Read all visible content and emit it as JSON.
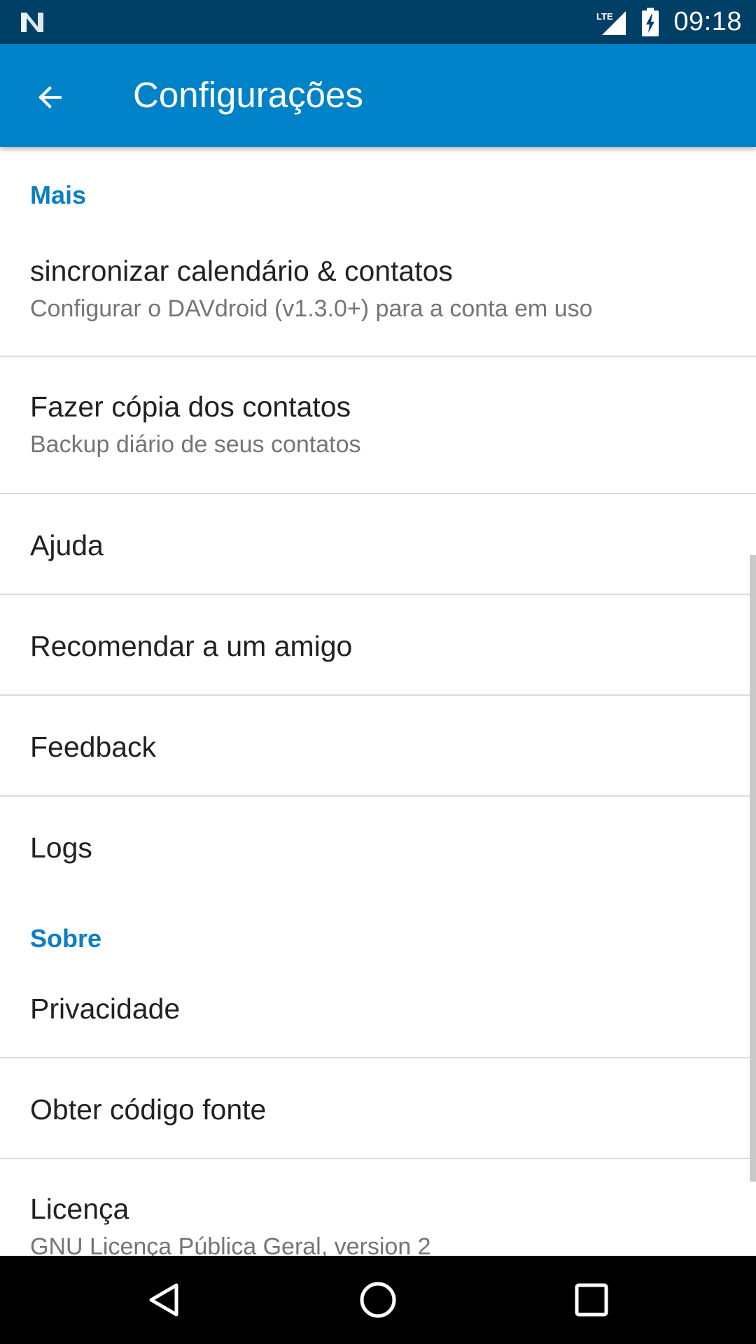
{
  "status_bar": {
    "time": "09:18",
    "network_label": "LTE",
    "icons": [
      "notification-n-icon",
      "lte-signal-icon",
      "battery-charging-icon"
    ]
  },
  "app_bar": {
    "title": "Configurações",
    "back_icon": "arrow-back-icon"
  },
  "sections": {
    "more": {
      "header": "Mais",
      "items": [
        {
          "title": "sincronizar calendário & contatos",
          "summary": "Configurar o DAVdroid (v1.3.0+) para a conta em uso"
        },
        {
          "title": "Fazer cópia dos contatos",
          "summary": "Backup diário de seus contatos"
        },
        {
          "title": "Ajuda"
        },
        {
          "title": "Recomendar a um amigo"
        },
        {
          "title": "Feedback"
        },
        {
          "title": "Logs"
        }
      ]
    },
    "about": {
      "header": "Sobre",
      "items": [
        {
          "title": "Privacidade"
        },
        {
          "title": "Obter código fonte"
        },
        {
          "title": "Licença",
          "summary": "GNU Licença Pública Geral, version 2"
        }
      ]
    }
  },
  "nav_bar": {
    "icons": [
      "nav-back-icon",
      "nav-home-icon",
      "nav-recents-icon"
    ]
  },
  "colors": {
    "status_bar": "#003f66",
    "app_bar": "#0082c8",
    "section_header": "#0b7fc2",
    "title_text": "#212121",
    "summary_text": "#757575",
    "divider": "#dadada"
  }
}
